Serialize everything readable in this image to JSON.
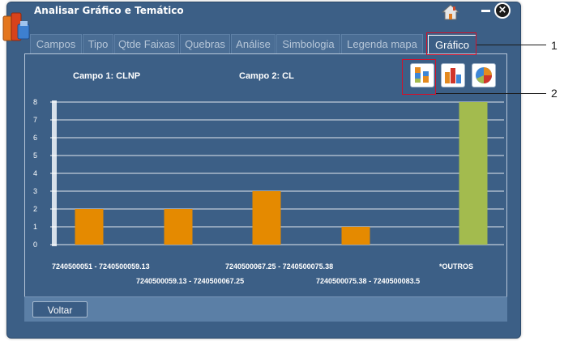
{
  "window": {
    "title": "Analisar Gráfico e Temático",
    "close_glyph": "×",
    "icons": [
      "app-icon",
      "home-icon",
      "minimize-icon",
      "close-icon"
    ]
  },
  "tabs": [
    {
      "label": "Campos",
      "active": false
    },
    {
      "label": "Tipo",
      "active": false
    },
    {
      "label": "Qtde Faixas",
      "active": false
    },
    {
      "label": "Quebras",
      "active": false
    },
    {
      "label": "Análise",
      "active": false
    },
    {
      "label": "Simbologia",
      "active": false
    },
    {
      "label": "Legenda mapa",
      "active": false
    },
    {
      "label": "Gráfico",
      "active": true
    }
  ],
  "campo1": "Campo 1: CLNP",
  "campo2": "Campo 2: CL",
  "chart_type_buttons": [
    "stacked-bar-icon",
    "bar-chart-icon",
    "pie-chart-icon"
  ],
  "chart_data": {
    "type": "bar",
    "categories": [
      "7240500051 - 7240500059.13",
      "7240500059.13 - 7240500067.25",
      "7240500067.25 - 7240500075.38",
      "7240500075.38 - 7240500083.5",
      "*OUTROS"
    ],
    "values": [
      2,
      2,
      3,
      1,
      8
    ],
    "colors": [
      "#e58a00",
      "#e58a00",
      "#e58a00",
      "#e58a00",
      "#a3bb4e"
    ],
    "ylim": [
      0,
      8
    ],
    "yticks": [
      0,
      1,
      2,
      3,
      4,
      5,
      6,
      7,
      8
    ],
    "grid": true
  },
  "footer": {
    "voltar_label": "Voltar"
  },
  "callouts": [
    "1",
    "2"
  ]
}
